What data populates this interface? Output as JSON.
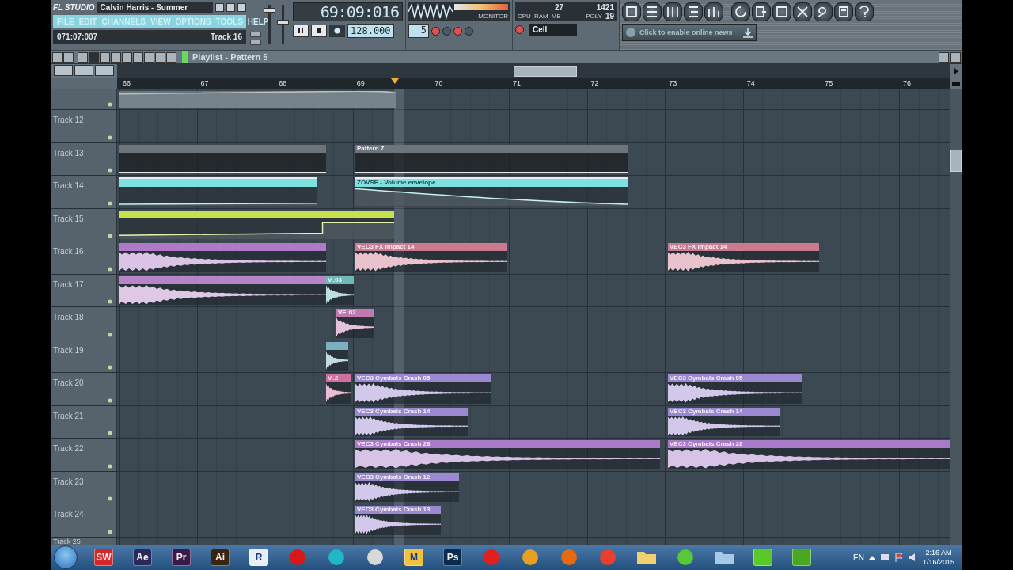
{
  "window": {
    "logo": "FL STUDIO",
    "title": "Calvin Harris - Summer"
  },
  "menu": [
    "FILE",
    "EDIT",
    "CHANNELS",
    "VIEW",
    "OPTIONS",
    "TOOLS",
    "HELP"
  ],
  "hint_bar": {
    "position": "071:07:007",
    "target": "Track 16"
  },
  "master_volume": {
    "level": 0.85
  },
  "master_pitch": {
    "level": 0.55
  },
  "transport": {
    "time": "69:09:016",
    "tempo": "128.000",
    "pattern": "5"
  },
  "monitor": {
    "label": "MONITOR"
  },
  "performance": {
    "cpu": "27",
    "ram": "1421",
    "ram_label": "RAM",
    "ram_unit": "MB",
    "cpu_label": "CPU",
    "poly_label": "POLY",
    "poly": "19"
  },
  "snap": "Cell",
  "news": {
    "placeholder": "Click to enable online news"
  },
  "playlist": {
    "title": "Playlist - Pattern 5",
    "ruler": [
      "66",
      "67",
      "68",
      "69",
      "70",
      "71",
      "72",
      "73",
      "74",
      "75",
      "76"
    ],
    "tracks": [
      {
        "clips": [
          {
            "kind": "automation",
            "color": "#6a747c"
          }
        ]
      },
      {
        "name": "Track 12"
      },
      {
        "name": "Track 13",
        "clips": [
          {
            "kind": "pattern",
            "color": "#6c747c"
          },
          {
            "kind": "pattern",
            "color": "#6c747c",
            "label": "Pattern 7"
          }
        ]
      },
      {
        "name": "Track 14",
        "clips": [
          {
            "kind": "automation",
            "color": "#7fe0e0"
          },
          {
            "kind": "automation",
            "color": "#7fe0e0",
            "label": "ZOVSE - Volume envelope"
          }
        ]
      },
      {
        "name": "Track 15",
        "clips": [
          {
            "kind": "automation",
            "color": "#c8e050"
          }
        ]
      },
      {
        "name": "Track 16",
        "clips": [
          {
            "kind": "audio",
            "color": "#b07ac8"
          },
          {
            "kind": "audio",
            "color": "#cc7a92",
            "label": "VEC3 FX Impact 14"
          },
          {
            "kind": "audio",
            "color": "#cc7a92",
            "label": "VEC3 FX Impact 14"
          }
        ]
      },
      {
        "name": "Track 17",
        "clips": [
          {
            "kind": "audio",
            "color": "#b884c8"
          },
          {
            "kind": "audio",
            "color": "#6fb8b8",
            "label": "V..03"
          }
        ]
      },
      {
        "name": "Track 18",
        "clips": [
          {
            "kind": "audio",
            "color": "#c07ab0",
            "label": "VF..02"
          }
        ]
      },
      {
        "name": "Track 19",
        "clips": [
          {
            "kind": "audio",
            "color": "#7ab0c0"
          }
        ]
      },
      {
        "name": "Track 20",
        "clips": [
          {
            "kind": "audio",
            "color": "#d070a0",
            "label": "V..2"
          },
          {
            "kind": "audio",
            "color": "#9a88d0",
            "label": "VEC3 Cymbals Crash 05"
          },
          {
            "kind": "audio",
            "color": "#9a88d0",
            "label": "VEC3 Cymbals Crash 05"
          }
        ]
      },
      {
        "name": "Track 21",
        "clips": [
          {
            "kind": "audio",
            "color": "#9a88d0",
            "label": "VEC3 Cymbals Crash 14"
          },
          {
            "kind": "audio",
            "color": "#9a88d0",
            "label": "VEC3 Cymbals Crash 14"
          }
        ]
      },
      {
        "name": "Track 22",
        "clips": [
          {
            "kind": "audio",
            "color": "#a87ac8",
            "label": "VEC3 Cymbals Crash 28"
          },
          {
            "kind": "audio",
            "color": "#a87ac8",
            "label": "VEC3 Cymbals Crash 28"
          }
        ]
      },
      {
        "name": "Track 23",
        "clips": [
          {
            "kind": "audio",
            "color": "#9a88d0",
            "label": "VEC3 Cymbals Crash 12"
          }
        ]
      },
      {
        "name": "Track 24",
        "clips": [
          {
            "kind": "audio",
            "color": "#9a88d0",
            "label": "VEC3 Cymbals Crash 13"
          }
        ]
      },
      {
        "name": "Track 25"
      }
    ]
  },
  "taskbar": {
    "apps": [
      {
        "kind": "tile",
        "label": "SW",
        "color": "#d02828"
      },
      {
        "kind": "tile",
        "label": "Ae",
        "color": "#2a2a5a"
      },
      {
        "kind": "tile",
        "label": "Pr",
        "color": "#3a1a4a"
      },
      {
        "kind": "tile",
        "label": "Ai",
        "color": "#3a2410"
      },
      {
        "kind": "tile",
        "label": "R",
        "color": "#e8eef8"
      },
      {
        "kind": "round",
        "color": "#d81818"
      },
      {
        "kind": "round",
        "color": "#20b8c8"
      },
      {
        "kind": "round",
        "color": "#d8d8d8"
      },
      {
        "kind": "tile",
        "label": "M",
        "color": "#f0c040"
      },
      {
        "kind": "tile",
        "label": "Ps",
        "color": "#0c2a4a"
      },
      {
        "kind": "round",
        "color": "#e02020"
      },
      {
        "kind": "round",
        "color": "#e8a020"
      },
      {
        "kind": "round",
        "color": "#e86a10"
      },
      {
        "kind": "round",
        "color": "#e84030"
      },
      {
        "kind": "folder",
        "color": "#f0d070"
      },
      {
        "kind": "round",
        "color": "#58c838"
      },
      {
        "kind": "folder",
        "color": "#a8c8e8"
      },
      {
        "kind": "tile",
        "color": "#5ac828"
      },
      {
        "kind": "tile",
        "color": "#4aa820"
      }
    ],
    "language": "EN",
    "time": "2:16 AM",
    "date": "1/16/2015"
  }
}
